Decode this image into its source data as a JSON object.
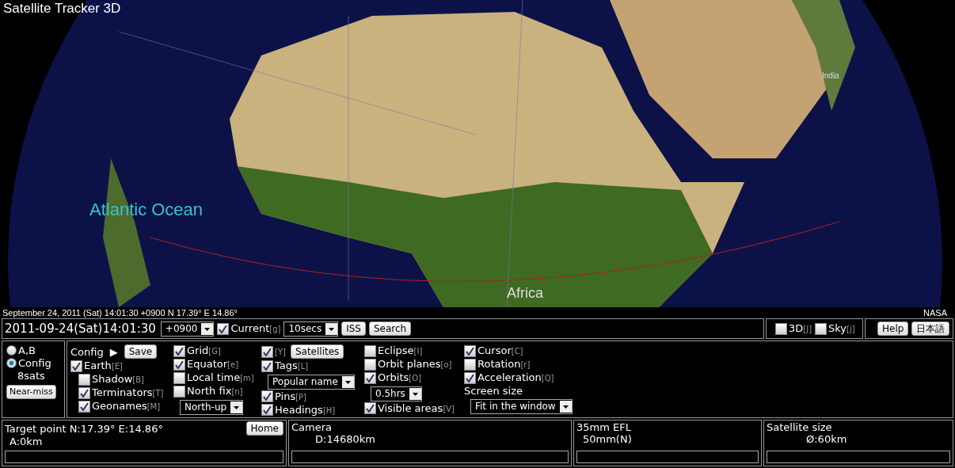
{
  "title": "Satellite Tracker 3D",
  "map_labels": [
    {
      "text": "Atlantic Ocean",
      "kind": "ocean"
    },
    {
      "text": "Africa",
      "kind": "continent"
    },
    {
      "text": "India",
      "kind": "country"
    }
  ],
  "status_line": {
    "left": "September 24, 2011 (Sat) 14:01:30 +0900 N 17.39° E 14.86°",
    "right": "NASA"
  },
  "time_bar": {
    "datetime": "2011-09-24(Sat)14:01:30",
    "timezone": "+0900",
    "current": {
      "label": "Current",
      "key": "[g]",
      "checked": true
    },
    "step": "10secs",
    "buttons": [
      "ISS",
      "Search"
    ]
  },
  "view_toggles": [
    {
      "label": "3D",
      "key": "[J]",
      "checked": false
    },
    {
      "label": "Sky",
      "key": "[j]",
      "checked": false
    }
  ],
  "side_buttons": [
    "Help",
    "日本語"
  ],
  "mode": {
    "radios": [
      {
        "label": "A,B",
        "selected": false
      },
      {
        "label": "Config",
        "selected": true
      }
    ],
    "count": "8sats",
    "button": "Near-miss"
  },
  "columns": [
    [
      {
        "kind": "header",
        "label": "Config",
        "arrow": "▶",
        "button": "Save"
      },
      {
        "kind": "check",
        "label": "Earth",
        "key": "[E]",
        "checked": true,
        "children": [
          {
            "kind": "check",
            "label": "Shadow",
            "key": "[B]",
            "checked": false
          },
          {
            "kind": "check",
            "label": "Terminators",
            "key": "[T]",
            "checked": true
          },
          {
            "kind": "check",
            "label": "Geonames",
            "key": "[M]",
            "checked": true
          }
        ]
      }
    ],
    [
      {
        "kind": "check",
        "label": "Grid",
        "key": "[G]",
        "checked": true
      },
      {
        "kind": "check",
        "label": "Equator",
        "key": "[e]",
        "checked": true
      },
      {
        "kind": "check",
        "label": "Local time",
        "key": "[m]",
        "checked": false
      },
      {
        "kind": "check",
        "label": "North fix",
        "key": "[n]",
        "checked": false
      },
      {
        "kind": "select",
        "value": "North-up"
      }
    ],
    [
      {
        "kind": "check_button",
        "key": "[Y]",
        "checked": true,
        "button": "Satellites"
      },
      {
        "kind": "check",
        "label": "Tags",
        "key": "[L]",
        "checked": true
      },
      {
        "kind": "select",
        "value": "Popular name"
      },
      {
        "kind": "check",
        "label": "Pins",
        "key": "[P]",
        "checked": true
      },
      {
        "kind": "check",
        "label": "Headings",
        "key": "[H]",
        "checked": true
      }
    ],
    [
      {
        "kind": "check",
        "label": "Eclipse",
        "key": "[I]",
        "checked": false
      },
      {
        "kind": "check",
        "label": "Orbit planes",
        "key": "[o]",
        "checked": false
      },
      {
        "kind": "check",
        "label": "Orbits",
        "key": "[O]",
        "checked": true
      },
      {
        "kind": "select",
        "value": "0.5hrs"
      },
      {
        "kind": "check",
        "label": "Visible areas",
        "key": "[V]",
        "checked": true
      }
    ],
    [
      {
        "kind": "check",
        "label": "Cursor",
        "key": "[C]",
        "checked": true
      },
      {
        "kind": "check",
        "label": "Rotation",
        "key": "[r]",
        "checked": false
      },
      {
        "kind": "check",
        "label": "Acceleration",
        "key": "[Q]",
        "checked": true
      },
      {
        "kind": "text",
        "label": "Screen size"
      },
      {
        "kind": "select",
        "value": "Fit in the window"
      }
    ]
  ],
  "info_panels": [
    {
      "title": "Target point N:17.39° E:14.86°",
      "button": "Home",
      "value": "A:0km"
    },
    {
      "title": "Camera",
      "value": "D:14680km"
    },
    {
      "title": "35mm EFL",
      "value": "50mm(N)"
    },
    {
      "title": "Satellite size",
      "value": "Ø:60km"
    }
  ]
}
